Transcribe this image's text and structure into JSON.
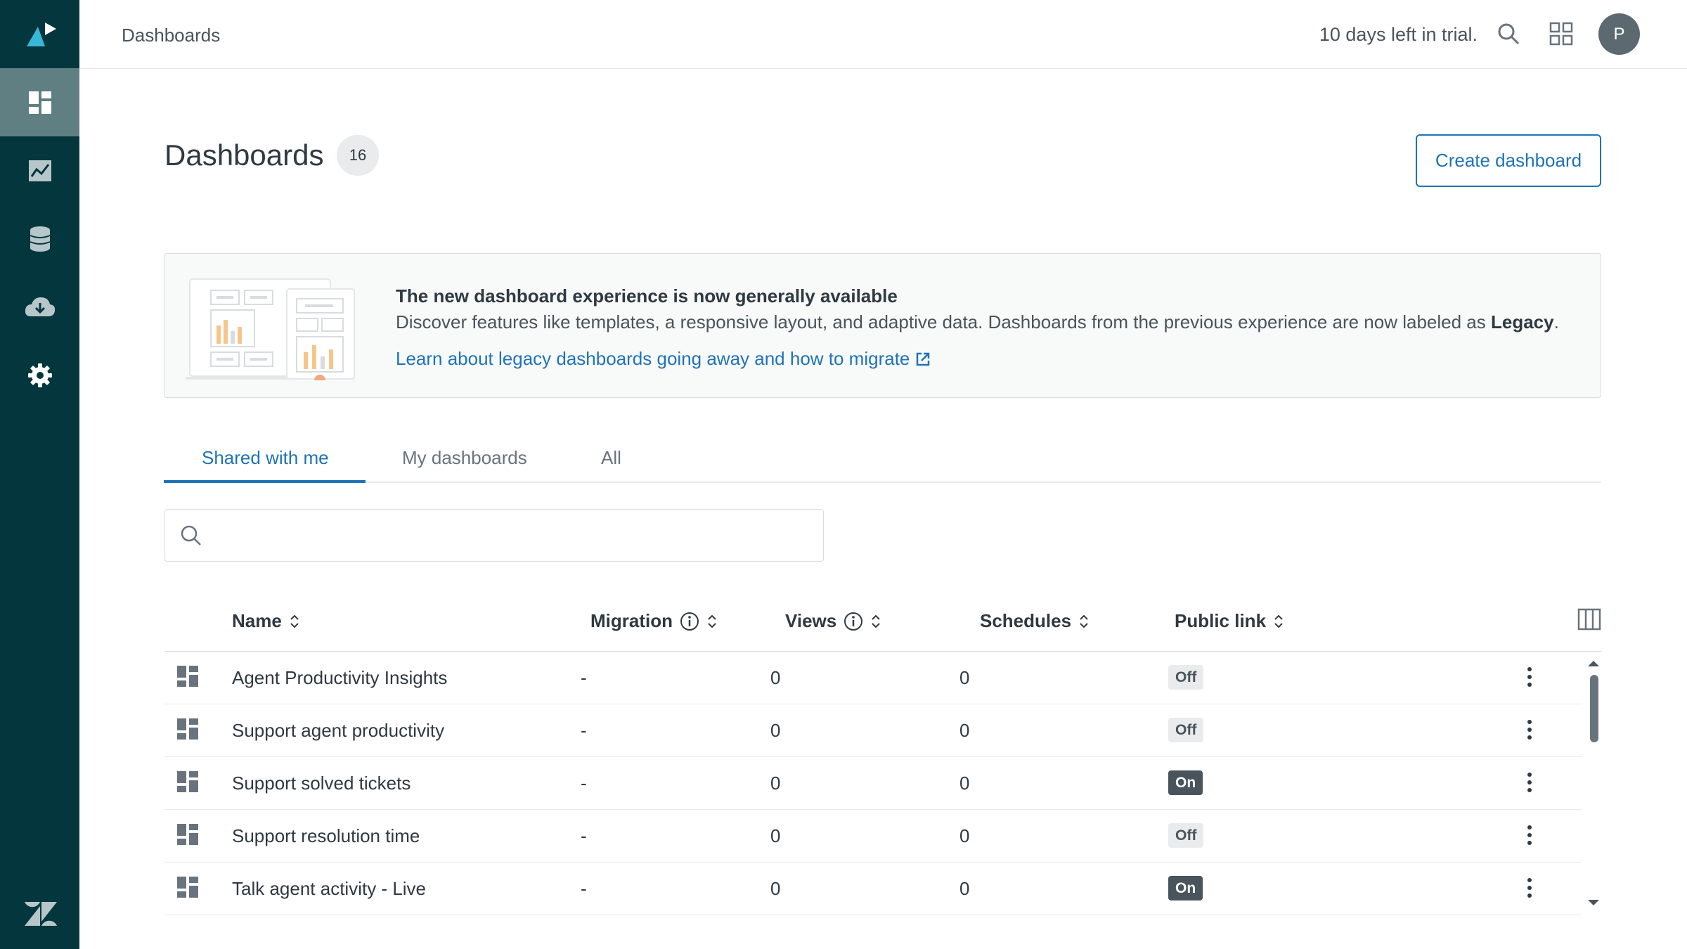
{
  "topbar": {
    "title": "Dashboards",
    "trial_text": "10 days left in trial.",
    "avatar_initial": "P"
  },
  "page": {
    "title": "Dashboards",
    "count": "16",
    "create_button": "Create dashboard"
  },
  "banner": {
    "title": "The new dashboard experience is now generally available",
    "desc_pre": "Discover features like templates, a responsive layout, and adaptive data. Dashboards from the previous experience are now labeled as ",
    "desc_bold": "Legacy",
    "desc_post": ".",
    "link": "Learn about legacy dashboards going away and how to migrate"
  },
  "tabs": [
    {
      "label": "Shared with me",
      "active": true
    },
    {
      "label": "My dashboards",
      "active": false
    },
    {
      "label": "All",
      "active": false
    }
  ],
  "search": {
    "placeholder": "",
    "value": ""
  },
  "table": {
    "columns": [
      "Name",
      "Migration",
      "Views",
      "Schedules",
      "Public link"
    ],
    "rows": [
      {
        "name": "Agent Productivity Insights",
        "migration": "-",
        "views": "0",
        "schedules": "0",
        "public_link": "Off"
      },
      {
        "name": "Support agent productivity",
        "migration": "-",
        "views": "0",
        "schedules": "0",
        "public_link": "Off"
      },
      {
        "name": "Support solved tickets",
        "migration": "-",
        "views": "0",
        "schedules": "0",
        "public_link": "On"
      },
      {
        "name": "Support resolution time",
        "migration": "-",
        "views": "0",
        "schedules": "0",
        "public_link": "Off"
      },
      {
        "name": "Talk agent activity - Live",
        "migration": "-",
        "views": "0",
        "schedules": "0",
        "public_link": "On"
      }
    ]
  },
  "icons": {
    "sidebar": [
      "dashboards-icon",
      "reports-icon",
      "datasets-icon",
      "download-icon",
      "settings-icon"
    ],
    "top": [
      "search-icon",
      "apps-grid-icon"
    ]
  },
  "colors": {
    "sidebar_bg": "#03363d",
    "sidebar_active": "#5f7f83",
    "accent": "#1f73b7",
    "pill_on": "#49545c",
    "pill_off": "#e9ebed"
  }
}
